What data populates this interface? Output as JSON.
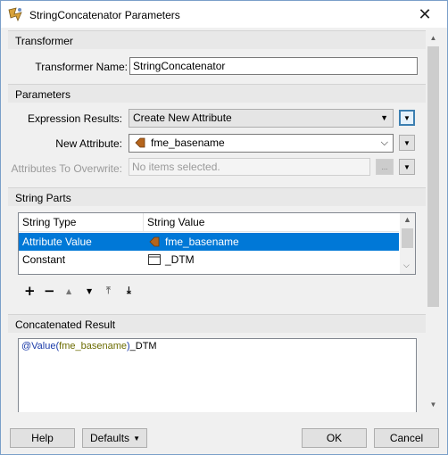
{
  "window": {
    "title": "StringConcatenator Parameters",
    "close_glyph": "✕"
  },
  "transformer": {
    "section_label": "Transformer",
    "name_label": "Transformer Name:",
    "name_value": "StringConcatenator"
  },
  "parameters": {
    "section_label": "Parameters",
    "expression_results_label": "Expression Results:",
    "expression_results_value": "Create New Attribute",
    "new_attribute_label": "New Attribute:",
    "new_attribute_value": "fme_basename",
    "attributes_to_overwrite_label": "Attributes To Overwrite:",
    "attributes_to_overwrite_placeholder": "No items selected.",
    "ellipsis": "..."
  },
  "string_parts": {
    "section_label": "String Parts",
    "columns": [
      "String Type",
      "String Value"
    ],
    "rows": [
      {
        "type": "Attribute Value",
        "value": "fme_basename",
        "icon": "attribute-icon",
        "selected": true
      },
      {
        "type": "Constant",
        "value": "_DTM",
        "icon": "constant-icon",
        "selected": false
      }
    ],
    "toolbar": {
      "add": "+",
      "remove": "−",
      "move_up": "▲",
      "move_down": "▼",
      "move_top": "⤒",
      "move_bottom": "⤓"
    }
  },
  "concatenated_result": {
    "section_label": "Concatenated Result",
    "fn_open": "@Value(",
    "attr": "fme_basename",
    "fn_close": ")",
    "suffix": "_DTM"
  },
  "buttons": {
    "help": "Help",
    "defaults": "Defaults",
    "defaults_arrow": "▼",
    "ok": "OK",
    "cancel": "Cancel"
  },
  "colors": {
    "selection": "#0078d7",
    "accent_border": "#3c7fb1",
    "attribute_icon": "#b5651d"
  }
}
